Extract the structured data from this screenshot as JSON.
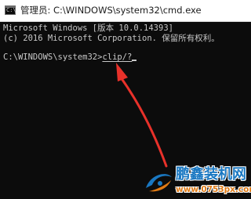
{
  "window": {
    "title": "管理员: C:\\WINDOWS\\system32\\cmd.exe",
    "icon": "console-icon"
  },
  "console": {
    "background": "#0c0c0c",
    "text_color": "#c8c8c8",
    "lines": [
      "Microsoft Windows [版本 10.0.14393]",
      "(c) 2016 Microsoft Corporation. 保留所有权利。"
    ],
    "prompt": "C:\\WINDOWS\\system32>",
    "command": "clip/?"
  },
  "annotation": {
    "color": "#e8312a",
    "icon": "red-arrow-icon"
  },
  "watermark": {
    "title": "鹏鑫装机网",
    "url": "www.0753px.com",
    "title_color": "#1a78c2",
    "url_color": "#e07a14"
  }
}
